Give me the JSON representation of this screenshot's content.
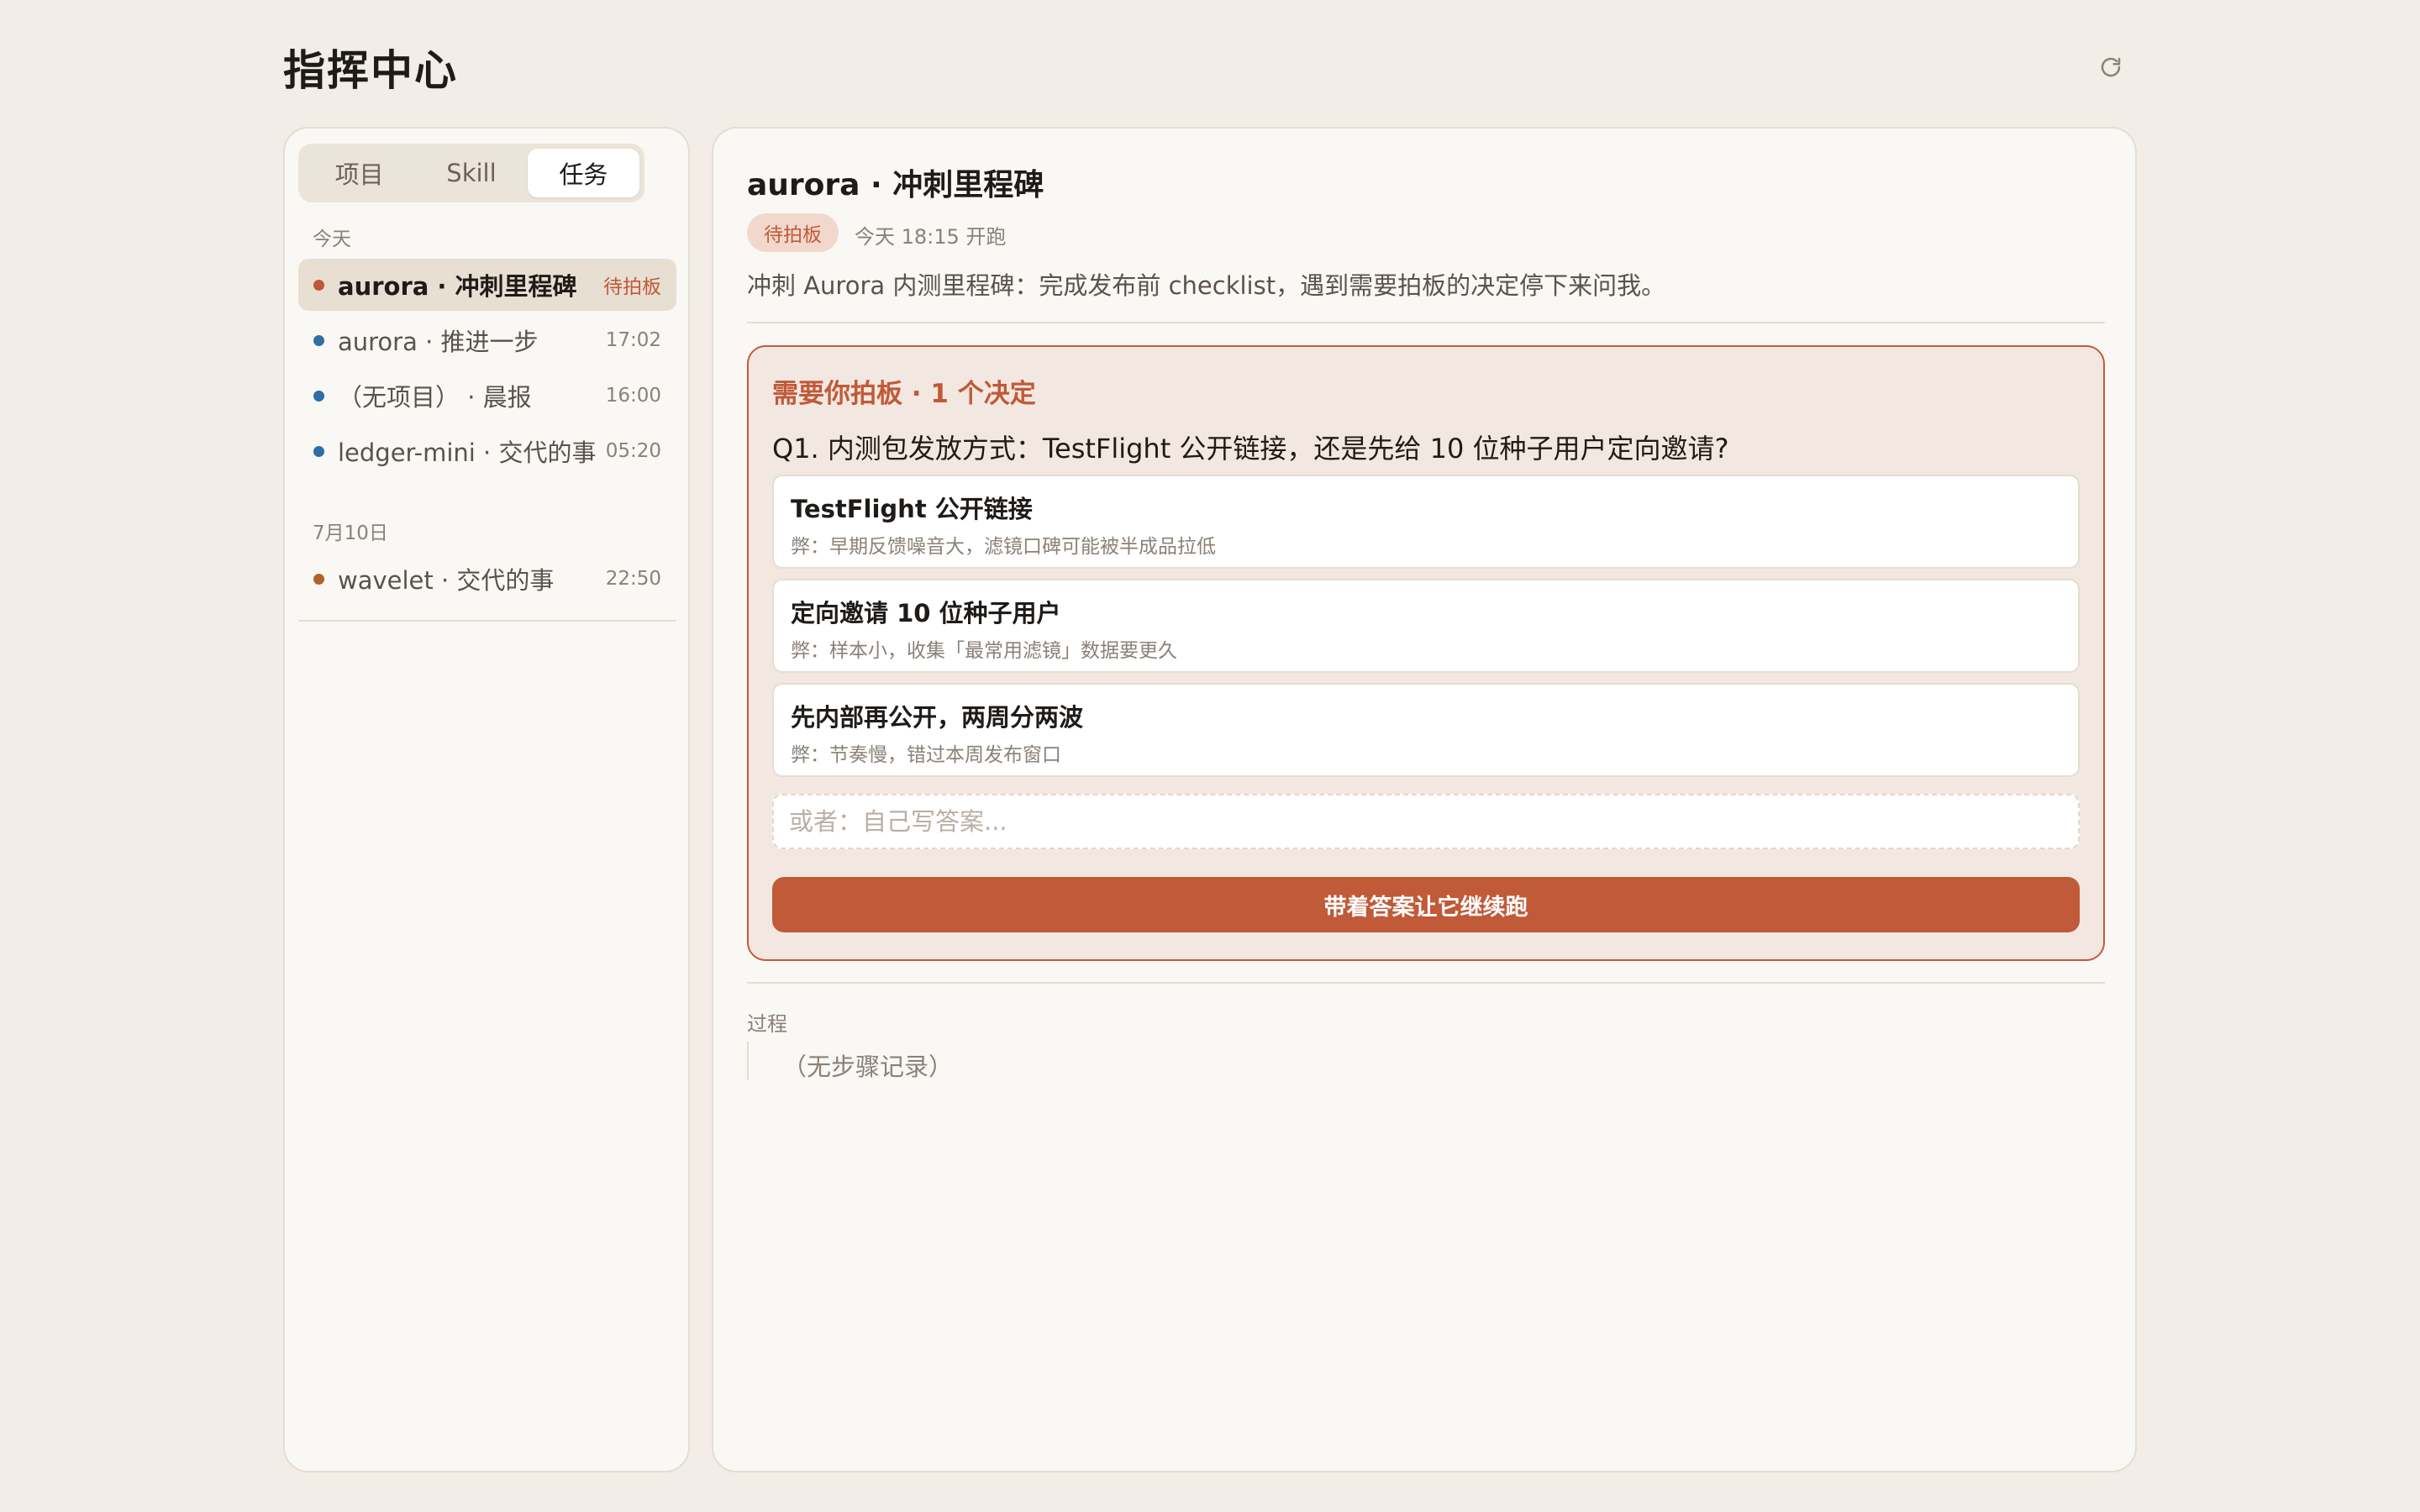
{
  "header": {
    "title": "指挥中心",
    "refresh_icon": "refresh-icon"
  },
  "sidebar": {
    "tabs": [
      {
        "label": "项目",
        "active": false
      },
      {
        "label": "Skill",
        "active": false
      },
      {
        "label": "任务",
        "active": true
      }
    ],
    "groups": [
      {
        "label": "今天",
        "tasks": [
          {
            "name": "aurora · 冲刺里程碑",
            "meta": "待拍板",
            "dot_color": "#c0573a",
            "active": true
          },
          {
            "name": "aurora · 推进一步",
            "meta": "17:02",
            "dot_color": "#2f6ea3",
            "active": false
          },
          {
            "name": "（无项目） · 晨报",
            "meta": "16:00",
            "dot_color": "#2f6ea3",
            "active": false
          },
          {
            "name": "ledger-mini · 交代的事",
            "meta": "05:20",
            "dot_color": "#2f6ea3",
            "active": false
          }
        ]
      },
      {
        "label": "7月10日",
        "tasks": [
          {
            "name": "wavelet · 交代的事",
            "meta": "22:50",
            "dot_color": "#b0632c",
            "active": false
          }
        ]
      }
    ]
  },
  "main": {
    "title": "aurora · 冲刺里程碑",
    "status": "待拍板",
    "start_time": "今天 18:15 开跑",
    "description": "冲刺 Aurora 内测里程碑：完成发布前 checklist，遇到需要拍板的决定停下来问我。",
    "decision": {
      "header": "需要你拍板 · 1 个决定",
      "question": "Q1. 内测包发放方式：TestFlight 公开链接，还是先给 10 位种子用户定向邀请?",
      "options": [
        {
          "title": "TestFlight 公开链接",
          "note": "弊：早期反馈噪音大，滤镜口碑可能被半成品拉低"
        },
        {
          "title": "定向邀请 10 位种子用户",
          "note": "弊：样本小，收集「最常用滤镜」数据要更久"
        },
        {
          "title": "先内部再公开，两周分两波",
          "note": "弊：节奏慢，错过本周发布窗口"
        }
      ],
      "custom_placeholder": "或者：自己写答案...",
      "submit_label": "带着答案让它继续跑"
    },
    "process": {
      "label": "过程",
      "empty_text": "（无步骤记录）"
    }
  },
  "colors": {
    "accent": "#c05a38",
    "background": "#f2ede6",
    "panel": "#faf8f4"
  }
}
